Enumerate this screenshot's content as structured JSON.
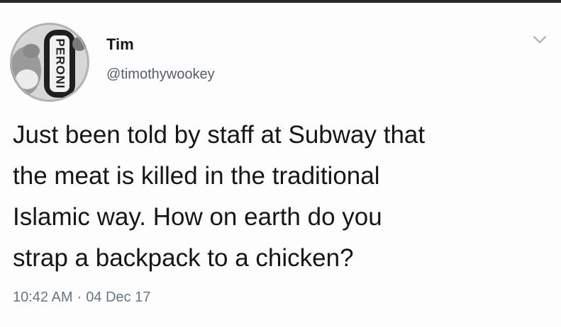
{
  "tweet": {
    "display_name": "Tim",
    "handle": "@timothywookey",
    "text_lines": [
      "Just been told by staff at Subway that",
      "the meat is killed in the traditional",
      "Islamic way. How on earth do you",
      "strap a backpack to a chicken?"
    ],
    "time": "10:42 AM",
    "separator": "·",
    "date": "04 Dec 17",
    "avatar_text": "PERONI"
  },
  "icons": {
    "menu": "chevron-down-icon"
  }
}
